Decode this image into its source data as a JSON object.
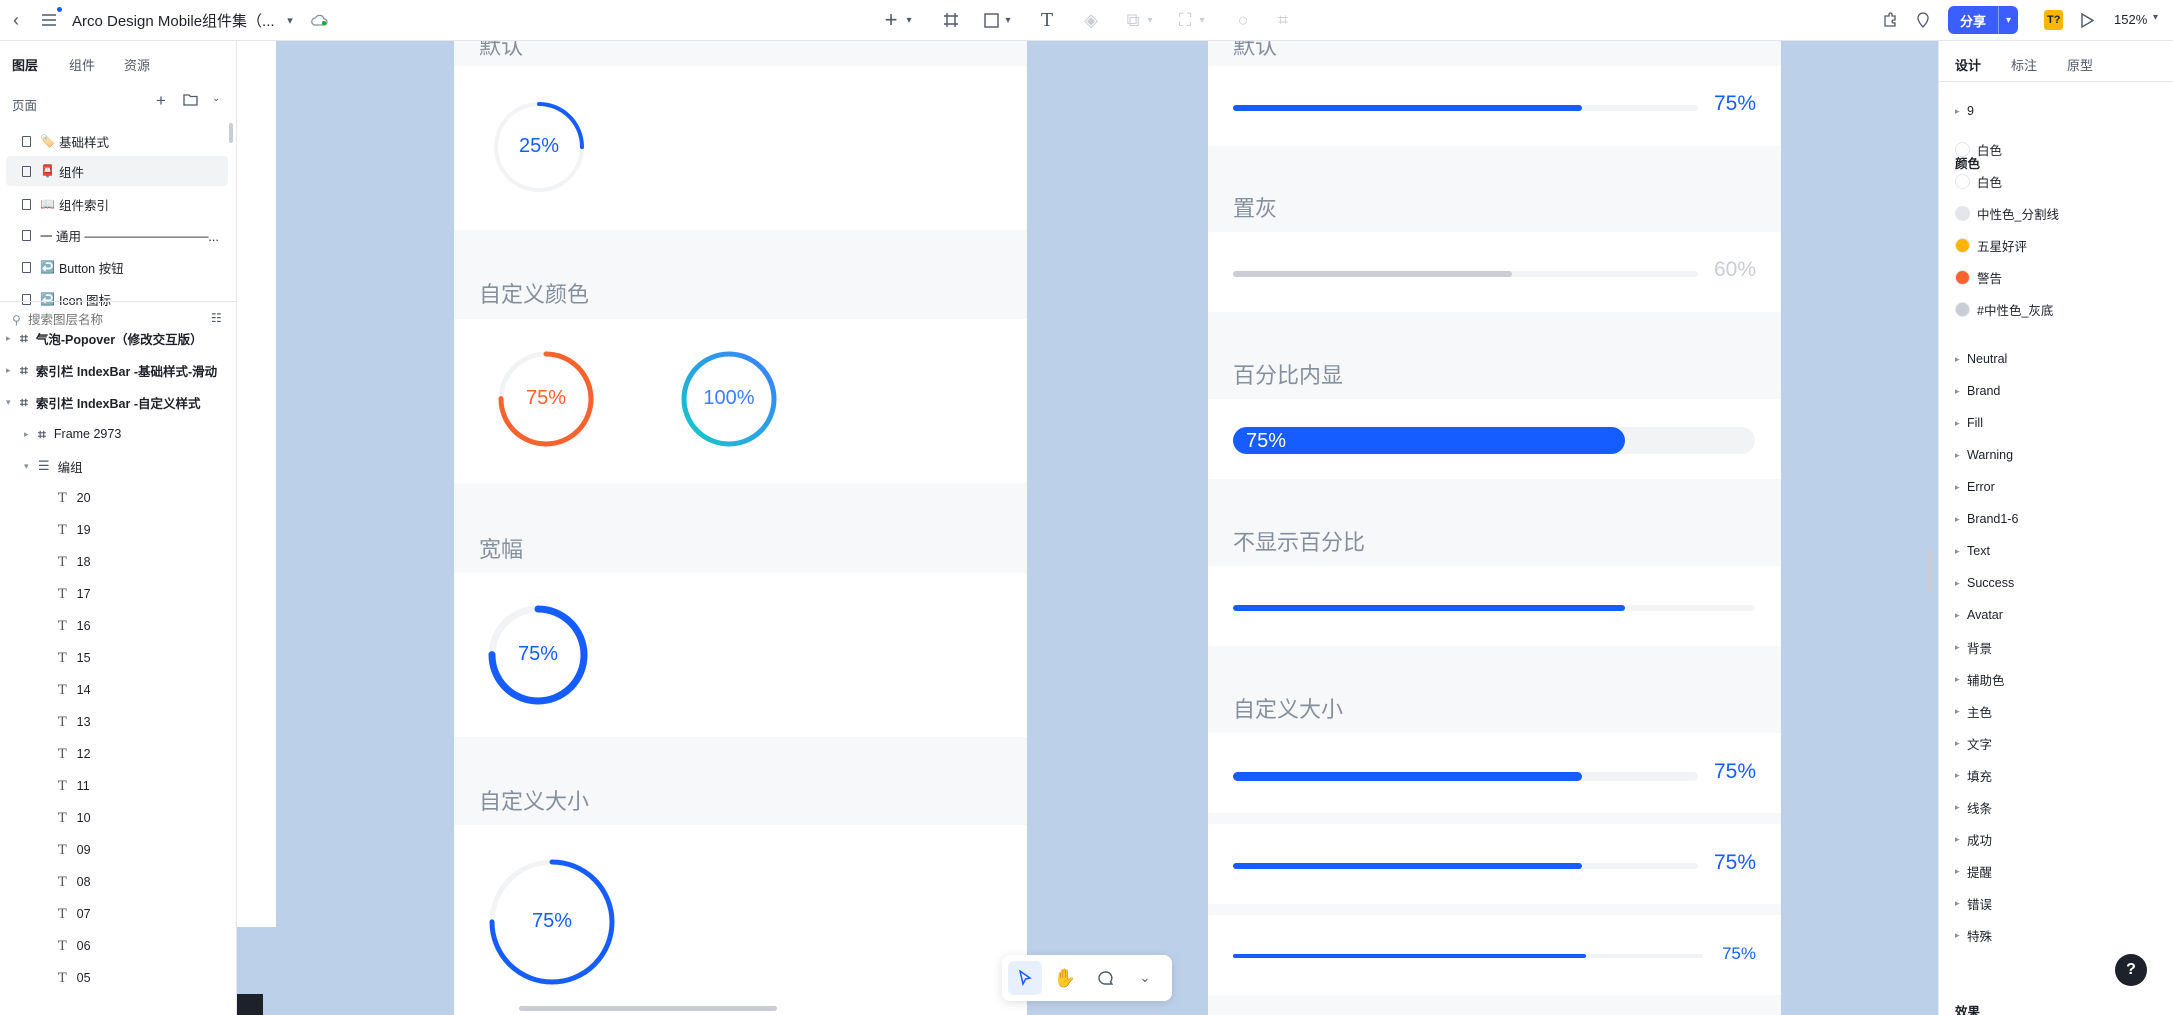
{
  "app": {
    "title": "Arco Design Mobile组件集（...",
    "zoom": "152%",
    "share_label": "分享",
    "badge": "T?"
  },
  "left": {
    "tabs": [
      "图层",
      "组件",
      "资源"
    ],
    "pages_label": "页面",
    "pages": [
      {
        "emoji": "🏷️",
        "label": "基础样式"
      },
      {
        "emoji": "📮",
        "label": "组件"
      },
      {
        "emoji": "📖",
        "label": "组件索引"
      },
      {
        "emoji": "",
        "label": "一 通用 ──────────────..."
      },
      {
        "emoji": "↩️",
        "label": "Button 按钮"
      },
      {
        "emoji": "↩️",
        "label": "Icon 图标"
      }
    ],
    "search_placeholder": "搜索图层名称",
    "layers": [
      {
        "label": "气泡-Popover（修改交互版）",
        "kind": "frame",
        "depth": 0,
        "caret": "▸"
      },
      {
        "label": "索引栏 IndexBar -基础样式-滑动",
        "kind": "frame",
        "depth": 0,
        "caret": "▸"
      },
      {
        "label": "索引栏 IndexBar -自定义样式",
        "kind": "frame",
        "depth": 0,
        "caret": "▾"
      },
      {
        "label": "Frame 2973",
        "kind": "frame",
        "depth": 1,
        "caret": "▸"
      },
      {
        "label": "编组",
        "kind": "group",
        "depth": 1,
        "caret": "▾"
      },
      {
        "label": "20",
        "kind": "text",
        "depth": 2
      },
      {
        "label": "19",
        "kind": "text",
        "depth": 2
      },
      {
        "label": "18",
        "kind": "text",
        "depth": 2
      },
      {
        "label": "17",
        "kind": "text",
        "depth": 2
      },
      {
        "label": "16",
        "kind": "text",
        "depth": 2
      },
      {
        "label": "15",
        "kind": "text",
        "depth": 2
      },
      {
        "label": "14",
        "kind": "text",
        "depth": 2
      },
      {
        "label": "13",
        "kind": "text",
        "depth": 2
      },
      {
        "label": "12",
        "kind": "text",
        "depth": 2
      },
      {
        "label": "11",
        "kind": "text",
        "depth": 2
      },
      {
        "label": "10",
        "kind": "text",
        "depth": 2
      },
      {
        "label": "09",
        "kind": "text",
        "depth": 2
      },
      {
        "label": "08",
        "kind": "text",
        "depth": 2
      },
      {
        "label": "07",
        "kind": "text",
        "depth": 2
      },
      {
        "label": "06",
        "kind": "text",
        "depth": 2
      },
      {
        "label": "05",
        "kind": "text",
        "depth": 2
      }
    ]
  },
  "canvas": {
    "left_phone": {
      "sections": [
        {
          "title": "默认"
        },
        {
          "title": "自定义颜色"
        },
        {
          "title": "宽幅"
        },
        {
          "title": "自定义大小"
        }
      ],
      "rings": [
        {
          "label": "25%",
          "value": 0.25,
          "color": "#165dff"
        },
        {
          "label": "75%",
          "value": 0.75,
          "color": "#f7632f"
        },
        {
          "label": "100%",
          "value": 1.0,
          "color": "#14c9c9",
          "gradient_to": "#3c7eff"
        },
        {
          "label": "75%",
          "value": 0.75,
          "color": "#165dff"
        },
        {
          "label": "75%",
          "value": 0.75,
          "color": "#165dff"
        }
      ]
    },
    "right_phone": {
      "sections": [
        {
          "title": "默认"
        },
        {
          "title": "置灰"
        },
        {
          "title": "百分比内显"
        },
        {
          "title": "不显示百分比"
        },
        {
          "title": "自定义大小"
        }
      ],
      "bars": [
        {
          "label": "75%",
          "value": 0.75,
          "color": "#165dff"
        },
        {
          "label": "60%",
          "value": 0.6,
          "color": "#c9cdd4",
          "label_color": "#c9cdd4"
        },
        {
          "label": "75%",
          "value": 0.75,
          "color": "#165dff",
          "inner": true
        },
        {
          "label": "",
          "value": 0.75,
          "color": "#165dff"
        },
        {
          "label": "75%",
          "value": 0.75,
          "color": "#165dff"
        },
        {
          "label": "75%",
          "value": 0.75,
          "color": "#165dff"
        },
        {
          "label": "75%",
          "value": 0.75,
          "color": "#165dff"
        }
      ]
    }
  },
  "right": {
    "tabs": [
      "设计",
      "标注",
      "原型"
    ],
    "top_item": "9",
    "colors_label": "颜色",
    "colors": [
      {
        "name": "白色",
        "hex": "#ffffff"
      },
      {
        "name": "白色",
        "hex": "#ffffff"
      },
      {
        "name": "中性色_分割线",
        "hex": "#e5e6eb"
      },
      {
        "name": "五星好评",
        "hex": "#ffb400"
      },
      {
        "name": "警告",
        "hex": "#f7632f"
      },
      {
        "name": "#中性色_灰底",
        "hex": "#c9cdd4"
      }
    ],
    "groups": [
      "Neutral",
      "Brand",
      "Fill",
      "Warning",
      "Error",
      "Brand1-6",
      "Text",
      "Success",
      "Avatar",
      "背景",
      "辅助色",
      "主色",
      "文字",
      "填充",
      "线条",
      "成功",
      "提醒",
      "错误",
      "特殊"
    ],
    "footer_label": "效果",
    "help": "?"
  },
  "tools": {
    "icons": [
      "select-icon",
      "hand-icon",
      "comment-icon",
      "more-icon"
    ]
  }
}
